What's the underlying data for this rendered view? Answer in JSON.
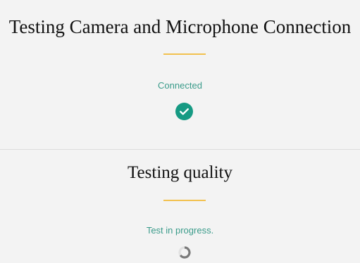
{
  "camera_mic_section": {
    "title": "Testing Camera and Microphone Connection",
    "status": "Connected",
    "status_icon": "check-circle-icon",
    "accent_color": "#f2c14e",
    "status_color": "#3a9b8a"
  },
  "quality_section": {
    "title": "Testing quality",
    "status": "Test in progress.",
    "status_icon": "loading-spinner-icon"
  }
}
